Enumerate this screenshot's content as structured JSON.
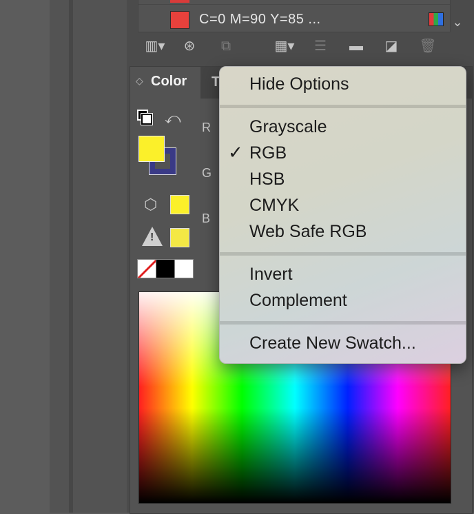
{
  "swatches": {
    "selected_swatch_name": "C=0 M=90 Y=85 ...",
    "swatch_color": "#e8413c"
  },
  "swatches_toolbar": {
    "icons": [
      "swatch-libraries-icon",
      "show-swatch-kinds-icon",
      "swatch-options-icon",
      "new-color-group-icon",
      "swatch-list-view-icon",
      "folder-icon",
      "new-swatch-icon",
      "trash-icon"
    ]
  },
  "color_panel": {
    "tab_label": "Color",
    "other_tab_label": "T",
    "channels": [
      "R",
      "G",
      "B"
    ],
    "fill_color": "#fbf02a",
    "stroke_color": "#3a3a86"
  },
  "context_menu": {
    "hide_options": "Hide Options",
    "modes": [
      "Grayscale",
      "RGB",
      "HSB",
      "CMYK",
      "Web Safe RGB"
    ],
    "selected_mode": "RGB",
    "check_mark": "✓",
    "invert": "Invert",
    "complement": "Complement",
    "create_new_swatch": "Create New Swatch..."
  }
}
